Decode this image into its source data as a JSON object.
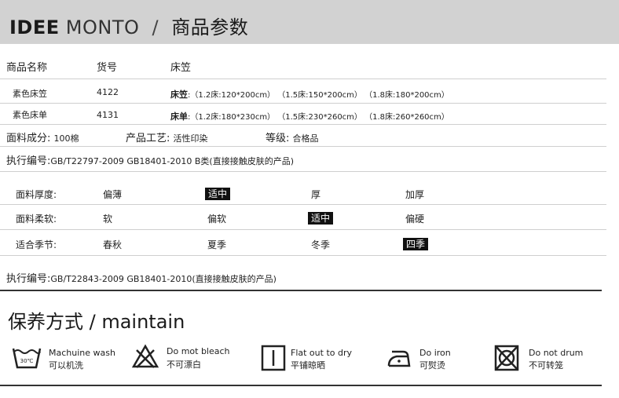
{
  "header": {
    "brand_bold": "IDEE",
    "brand_light": "MONTO",
    "separator": "/",
    "title": "商品参数"
  },
  "table": {
    "headers": [
      "商品名称",
      "货号",
      "床笠"
    ],
    "rows": [
      {
        "name": "素色床笠",
        "code": "4122",
        "label": "床笠",
        "sizes": ":（1.2床:120*200cm） （1.5床:150*200cm） （1.8床:180*200cm）"
      },
      {
        "name": "素色床单",
        "code": "4131",
        "label": "床单",
        "sizes": ":（1.2床:180*230cm） （1.5床:230*260cm） （1.8床:260*260cm）"
      }
    ]
  },
  "specs": {
    "fabric_label": "面料成分:",
    "fabric_value": "100棉",
    "craft_label": "产品工艺:",
    "craft_value": "活性印染",
    "grade_label": "等级:",
    "grade_value": "合格品",
    "standard1_label": "执行编号:",
    "standard1_value": "GB/T22797-2009 GB18401-2010  B类(直接接触皮肤的产品)"
  },
  "attributes": [
    {
      "label": "面料厚度:",
      "options": [
        "偏薄",
        "适中",
        "厚",
        "加厚"
      ],
      "selected": 1
    },
    {
      "label": "面料柔软:",
      "options": [
        "软",
        "偏软",
        "适中",
        "偏硬"
      ],
      "selected": 2
    },
    {
      "label": "适合季节:",
      "options": [
        "春秋",
        "夏季",
        "冬季",
        "四季"
      ],
      "selected": 3
    }
  ],
  "standard2": {
    "label": "执行编号:",
    "value": "GB/T22843-2009 GB18401-2010(直接接触皮肤的产品)"
  },
  "care": {
    "title": "保养方式 / maintain",
    "items": [
      {
        "icon": "machine-wash-icon",
        "icon_text": "30℃",
        "en": "Machuine wash",
        "cn": "可以机洗"
      },
      {
        "icon": "no-bleach-icon",
        "en": "Do mot bleach",
        "cn": "不可漂白"
      },
      {
        "icon": "flat-dry-icon",
        "en": "Flat out to dry",
        "cn": "平铺晾晒"
      },
      {
        "icon": "iron-icon",
        "en": "Do  iron",
        "cn": "可熨烫"
      },
      {
        "icon": "no-tumble-dry-icon",
        "en": "Do  not  drum",
        "cn": "不可转笼"
      }
    ]
  }
}
